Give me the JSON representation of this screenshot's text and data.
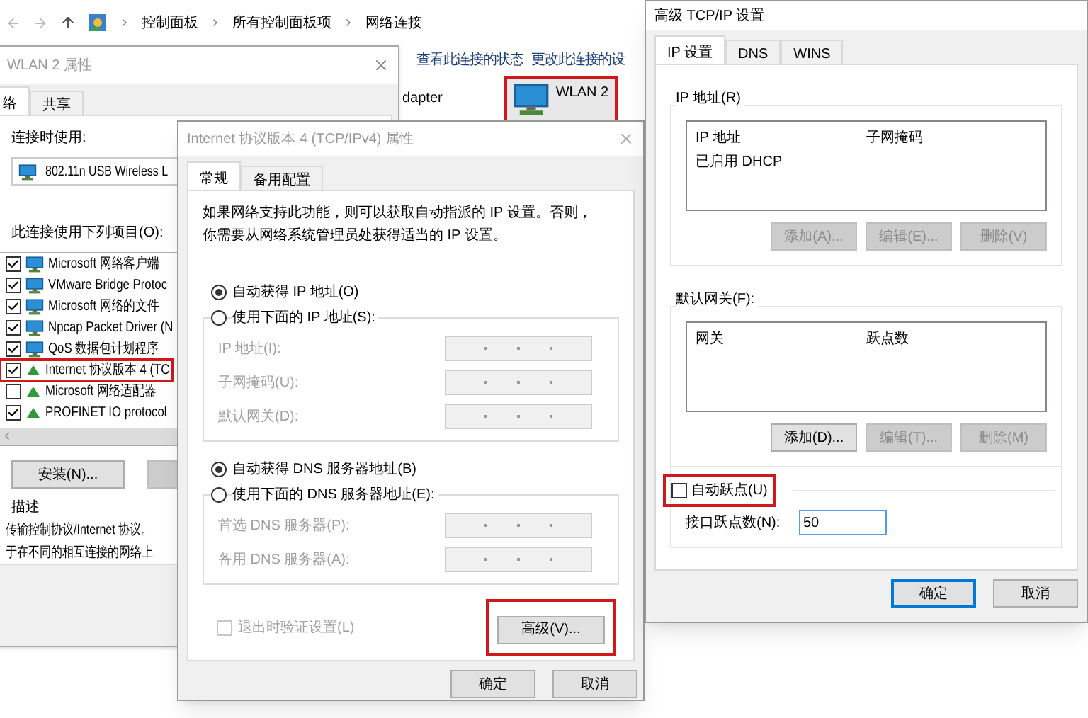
{
  "explorer": {
    "breadcrumb": [
      "控制面板",
      "所有控制面板项",
      "网络连接"
    ],
    "toolbar": [
      "查看此连接的状态",
      "更改此连接的设"
    ],
    "adapter_label": "dapter",
    "connection": {
      "name": "WLAN 2",
      "highlighted": true
    }
  },
  "wlan_dialog": {
    "title": "WLAN 2 属性",
    "tabs": [
      {
        "label": "络",
        "selected": true
      },
      {
        "label": "共享",
        "selected": false
      }
    ],
    "connect_using_label": "连接时使用:",
    "adapter": "802.11n USB Wireless L",
    "items_label": "此连接使用下列项目(O):",
    "items": [
      {
        "label": "Microsoft 网络客户端",
        "checked": true,
        "highlighted": false
      },
      {
        "label": "VMware Bridge Protoc",
        "checked": true,
        "highlighted": false
      },
      {
        "label": "Microsoft 网络的文件",
        "checked": true,
        "highlighted": false
      },
      {
        "label": "Npcap Packet Driver (N",
        "checked": true,
        "highlighted": false
      },
      {
        "label": "QoS 数据包计划程序",
        "checked": true,
        "highlighted": false
      },
      {
        "label": "Internet 协议版本 4 (TC",
        "checked": true,
        "highlighted": true
      },
      {
        "label": "Microsoft 网络适配器",
        "checked": false,
        "highlighted": false
      },
      {
        "label": "PROFINET IO protocol",
        "checked": true,
        "highlighted": false
      }
    ],
    "install_button": "安装(N)...",
    "description_label": "描述",
    "description": [
      "传输控制协议/Internet 协议。",
      "于在不同的相互连接的网络上"
    ]
  },
  "ipv4_dialog": {
    "title": "Internet 协议版本 4 (TCP/IPv4) 属性",
    "tabs": [
      {
        "label": "常规",
        "selected": true
      },
      {
        "label": "备用配置",
        "selected": false
      }
    ],
    "intro": "如果网络支持此功能，则可以获取自动指派的 IP 设置。否则，你需要从网络系统管理员处获得适当的 IP 设置。",
    "ip_modes": [
      {
        "label": "自动获得 IP 地址(O)",
        "selected": true
      },
      {
        "label": "使用下面的 IP 地址(S):",
        "selected": false
      }
    ],
    "ip_fields": [
      {
        "label": "IP 地址(I):",
        "disabled": true
      },
      {
        "label": "子网掩码(U):",
        "disabled": true
      },
      {
        "label": "默认网关(D):",
        "disabled": true
      }
    ],
    "dns_modes": [
      {
        "label": "自动获得 DNS 服务器地址(B)",
        "selected": true
      },
      {
        "label": "使用下面的 DNS 服务器地址(E):",
        "selected": false
      }
    ],
    "dns_fields": [
      {
        "label": "首选 DNS 服务器(P):",
        "disabled": true
      },
      {
        "label": "备用 DNS 服务器(A):",
        "disabled": true
      }
    ],
    "validate": {
      "label": "退出时验证设置(L)",
      "checked": false,
      "disabled": true
    },
    "advanced_button": {
      "label": "高级(V)...",
      "highlighted": true
    },
    "footer": [
      "确定",
      "取消"
    ]
  },
  "advanced_dialog": {
    "title": "高级 TCP/IP 设置",
    "tabs": [
      {
        "label": "IP 设置",
        "selected": true
      },
      {
        "label": "DNS",
        "selected": false
      },
      {
        "label": "WINS",
        "selected": false
      }
    ],
    "ip_group": {
      "label": "IP 地址(R)",
      "columns": [
        "IP 地址",
        "子网掩码"
      ],
      "rows": [
        [
          "已启用 DHCP"
        ]
      ],
      "buttons": [
        {
          "label": "添加(A)...",
          "disabled": true
        },
        {
          "label": "编辑(E)...",
          "disabled": true
        },
        {
          "label": "删除(V)",
          "disabled": true
        }
      ]
    },
    "gateway_group": {
      "label": "默认网关(F):",
      "columns": [
        "网关",
        "跃点数"
      ],
      "buttons": [
        {
          "label": "添加(D)...",
          "disabled": false
        },
        {
          "label": "编辑(T)...",
          "disabled": true
        },
        {
          "label": "删除(M)",
          "disabled": true
        }
      ]
    },
    "auto_metric": {
      "label": "自动跃点(U)",
      "checked": false,
      "highlighted": true
    },
    "metric": {
      "label": "接口跃点数(N):",
      "value": "50"
    },
    "footer": [
      {
        "label": "确定",
        "focused": true
      },
      {
        "label": "取消",
        "focused": false
      }
    ]
  }
}
